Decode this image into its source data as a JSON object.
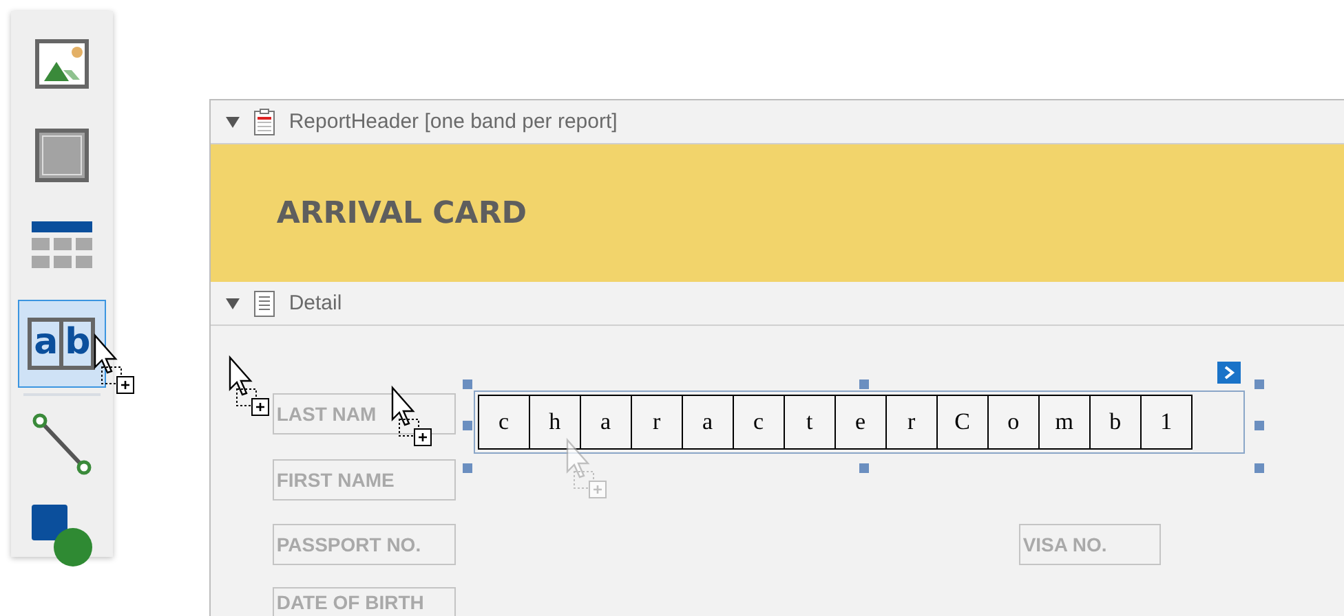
{
  "toolbar": {
    "items": [
      {
        "kind": "picture",
        "selected": false
      },
      {
        "kind": "panel",
        "selected": false
      },
      {
        "kind": "table",
        "selected": false
      },
      {
        "kind": "character-comb",
        "selected": true,
        "glyphs": [
          "a",
          "b"
        ]
      },
      {
        "kind": "separator"
      },
      {
        "kind": "line",
        "selected": false
      },
      {
        "kind": "shape",
        "selected": false
      }
    ]
  },
  "designer": {
    "bands": [
      {
        "kind": "report-header",
        "title": "ReportHeader [one band per report]",
        "expanded": true,
        "content_title": "ARRIVAL CARD"
      },
      {
        "kind": "detail",
        "title": "Detail",
        "expanded": true,
        "labels": [
          {
            "text": "LAST NAM"
          },
          {
            "text": "FIRST NAME"
          },
          {
            "text": "PASSPORT NO."
          },
          {
            "text": "DATE OF BIRTH"
          },
          {
            "text": "VISA NO."
          }
        ],
        "comb": {
          "selected": true,
          "characters": [
            "c",
            "h",
            "a",
            "r",
            "a",
            "c",
            "t",
            "e",
            "r",
            "C",
            "o",
            "m",
            "b",
            "1"
          ]
        }
      }
    ]
  }
}
